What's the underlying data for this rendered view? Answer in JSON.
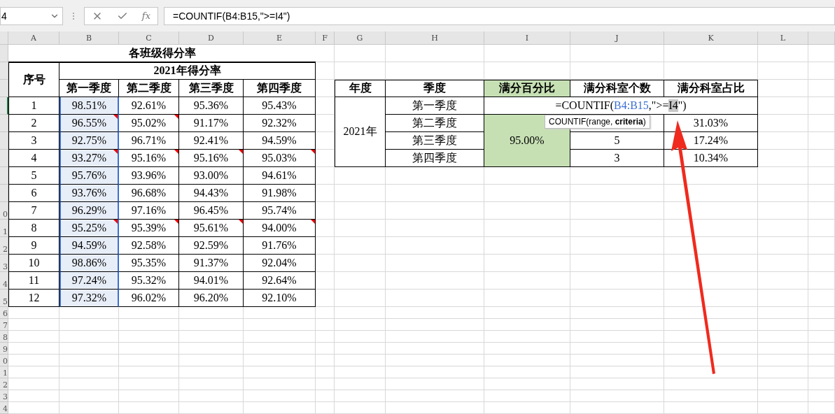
{
  "name_box": {
    "value": "4"
  },
  "formula_bar": {
    "function_button": "fx",
    "formula": "=COUNTIF(B4:B15,\">=I4\")"
  },
  "columns": [
    {
      "label": "A"
    },
    {
      "label": "B"
    },
    {
      "label": "C"
    },
    {
      "label": "D"
    },
    {
      "label": "E"
    },
    {
      "label": "F"
    },
    {
      "label": "G"
    },
    {
      "label": "H"
    },
    {
      "label": "I"
    },
    {
      "label": "J"
    },
    {
      "label": "K"
    },
    {
      "label": "L"
    },
    {}
  ],
  "row_headers": [
    {
      "active": false
    },
    {
      "active": false
    },
    {
      "active": false
    },
    {
      "active": true
    },
    {
      "active": false
    },
    {
      "active": false
    },
    {
      "active": false
    },
    {
      "active": false
    },
    {
      "active": false
    },
    {
      "active": false,
      "label": "0"
    },
    {
      "active": false,
      "label": "1"
    },
    {
      "active": false,
      "label": "2"
    },
    {
      "active": false,
      "label": "3"
    },
    {
      "active": false,
      "label": "4"
    },
    {
      "active": false,
      "label": "5"
    },
    {
      "active": false,
      "label": "6"
    },
    {
      "active": false,
      "label": "7"
    },
    {
      "active": false,
      "label": "8"
    },
    {
      "active": false,
      "label": "9"
    },
    {
      "active": false,
      "label": "0"
    },
    {
      "active": false,
      "label": "1"
    },
    {
      "active": false,
      "label": "2"
    },
    {
      "active": false,
      "label": "3"
    },
    {
      "active": false,
      "label": "4"
    }
  ],
  "score_table": {
    "title": "各班级得分率",
    "index_header": "序号",
    "group_header": "2021年得分率",
    "quarters": [
      "第一季度",
      "第二季度",
      "第三季度",
      "第四季度"
    ],
    "rows": [
      {
        "index": "1",
        "cells": [
          {
            "value": "98.51%",
            "comment": false,
            "selected": true
          },
          {
            "value": "92.61%",
            "comment": false,
            "selected": false
          },
          {
            "value": "95.36%",
            "comment": false,
            "selected": false
          },
          {
            "value": "95.43%",
            "comment": false,
            "selected": false
          }
        ]
      },
      {
        "index": "2",
        "cells": [
          {
            "value": "96.55%",
            "comment": true,
            "selected": true
          },
          {
            "value": "95.02%",
            "comment": true,
            "selected": false
          },
          {
            "value": "91.17%",
            "comment": false,
            "selected": false
          },
          {
            "value": "92.32%",
            "comment": false,
            "selected": false
          }
        ]
      },
      {
        "index": "3",
        "cells": [
          {
            "value": "92.75%",
            "comment": false,
            "selected": true
          },
          {
            "value": "96.71%",
            "comment": false,
            "selected": false
          },
          {
            "value": "92.41%",
            "comment": false,
            "selected": false
          },
          {
            "value": "94.59%",
            "comment": false,
            "selected": false
          }
        ]
      },
      {
        "index": "4",
        "cells": [
          {
            "value": "93.27%",
            "comment": true,
            "selected": true
          },
          {
            "value": "95.16%",
            "comment": true,
            "selected": false
          },
          {
            "value": "95.16%",
            "comment": true,
            "selected": false
          },
          {
            "value": "95.03%",
            "comment": true,
            "selected": false
          }
        ]
      },
      {
        "index": "5",
        "cells": [
          {
            "value": "95.76%",
            "comment": false,
            "selected": true
          },
          {
            "value": "93.96%",
            "comment": false,
            "selected": false
          },
          {
            "value": "93.00%",
            "comment": false,
            "selected": false
          },
          {
            "value": "94.61%",
            "comment": false,
            "selected": false
          }
        ]
      },
      {
        "index": "6",
        "cells": [
          {
            "value": "93.76%",
            "comment": false,
            "selected": true
          },
          {
            "value": "96.68%",
            "comment": false,
            "selected": false
          },
          {
            "value": "94.43%",
            "comment": false,
            "selected": false
          },
          {
            "value": "91.98%",
            "comment": false,
            "selected": false
          }
        ]
      },
      {
        "index": "7",
        "cells": [
          {
            "value": "96.29%",
            "comment": false,
            "selected": true
          },
          {
            "value": "97.16%",
            "comment": false,
            "selected": false
          },
          {
            "value": "96.45%",
            "comment": false,
            "selected": false
          },
          {
            "value": "95.74%",
            "comment": false,
            "selected": false
          }
        ]
      },
      {
        "index": "8",
        "cells": [
          {
            "value": "95.25%",
            "comment": true,
            "selected": true
          },
          {
            "value": "95.39%",
            "comment": true,
            "selected": false
          },
          {
            "value": "95.61%",
            "comment": true,
            "selected": false
          },
          {
            "value": "94.00%",
            "comment": true,
            "selected": false
          }
        ]
      },
      {
        "index": "9",
        "cells": [
          {
            "value": "94.59%",
            "comment": false,
            "selected": true
          },
          {
            "value": "92.58%",
            "comment": false,
            "selected": false
          },
          {
            "value": "92.59%",
            "comment": false,
            "selected": false
          },
          {
            "value": "91.76%",
            "comment": false,
            "selected": false
          }
        ]
      },
      {
        "index": "10",
        "cells": [
          {
            "value": "98.86%",
            "comment": false,
            "selected": true
          },
          {
            "value": "95.35%",
            "comment": false,
            "selected": false
          },
          {
            "value": "91.37%",
            "comment": false,
            "selected": false
          },
          {
            "value": "92.04%",
            "comment": false,
            "selected": false
          }
        ]
      },
      {
        "index": "11",
        "cells": [
          {
            "value": "97.24%",
            "comment": false,
            "selected": true
          },
          {
            "value": "95.32%",
            "comment": false,
            "selected": false
          },
          {
            "value": "94.01%",
            "comment": false,
            "selected": false
          },
          {
            "value": "92.64%",
            "comment": false,
            "selected": false
          }
        ]
      },
      {
        "index": "12",
        "cells": [
          {
            "value": "97.32%",
            "comment": false,
            "selected": true
          },
          {
            "value": "96.02%",
            "comment": false,
            "selected": false
          },
          {
            "value": "96.20%",
            "comment": false,
            "selected": false
          },
          {
            "value": "92.10%",
            "comment": false,
            "selected": false
          }
        ]
      }
    ]
  },
  "summary_table": {
    "headers": [
      {
        "label": "年度",
        "highlight": false
      },
      {
        "label": "季度",
        "highlight": false
      },
      {
        "label": "满分百分比",
        "highlight": true
      },
      {
        "label": "满分科室个数",
        "highlight": false
      },
      {
        "label": "满分科室占比",
        "highlight": false
      }
    ],
    "year": "2021年",
    "full_score_percent": "95.00%",
    "cell_formula": [
      {
        "text": "=COUNTIF(",
        "kind": "plain"
      },
      {
        "text": "B4:B15",
        "kind": "range"
      },
      {
        "text": ",\">=",
        "kind": "plain"
      },
      {
        "text": "I4",
        "kind": "ref"
      },
      {
        "text": "\")",
        "kind": "plain"
      }
    ],
    "rows": [
      {
        "quarter": "第一季度"
      },
      {
        "quarter": "第二季度",
        "share": "31.03%"
      },
      {
        "quarter": "第三季度",
        "count": "5",
        "share": "17.24%"
      },
      {
        "quarter": "第四季度",
        "count": "3",
        "share": "10.34%"
      }
    ]
  },
  "tooltip": {
    "text": "COUNTIF(range, **criteria**)"
  }
}
